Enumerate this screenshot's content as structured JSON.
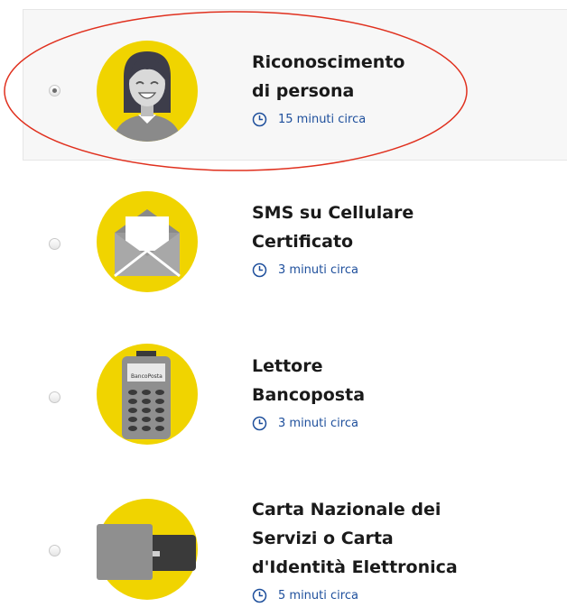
{
  "options": [
    {
      "title_lines": [
        "Riconoscimento",
        "di persona"
      ],
      "time": "15 minuti circa",
      "selected": true,
      "icon": "person-face-icon"
    },
    {
      "title_lines": [
        "SMS su Cellulare",
        "Certificato"
      ],
      "time": "3 minuti circa",
      "selected": false,
      "icon": "envelope-icon"
    },
    {
      "title_lines": [
        "Lettore",
        "Bancoposta"
      ],
      "time": "3 minuti circa",
      "selected": false,
      "icon": "card-reader-icon",
      "device_label": "BancoPosta"
    },
    {
      "title_lines": [
        "Carta Nazionale dei",
        "Servizi o Carta",
        "d'Identità Elettronica"
      ],
      "time": "5 minuti circa",
      "selected": false,
      "icon": "smart-card-icon"
    }
  ],
  "colors": {
    "accent_yellow": "#f0d400",
    "time_blue": "#1e4f9c",
    "highlight_red": "#e0301e"
  }
}
